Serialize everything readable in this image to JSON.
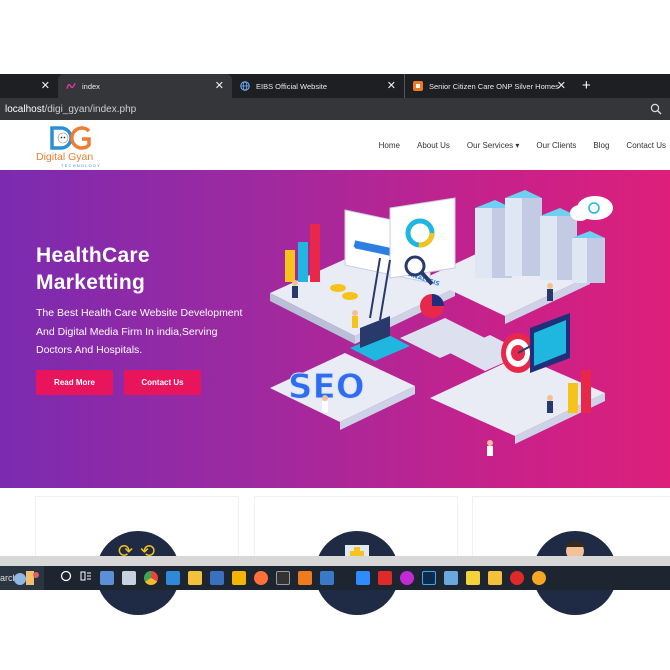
{
  "browser": {
    "tabs": [
      {
        "label": ""
      },
      {
        "label": "index"
      },
      {
        "label": "EIBS Official Website"
      },
      {
        "label": "Senior Citizen Care ONP Silver Homes"
      }
    ],
    "new_tab": "+",
    "close_glyph": "✕",
    "url_host": "localhost",
    "url_path": "/digi_gyan/index.php"
  },
  "site": {
    "logo_text": "Digital Gyan",
    "logo_sub": "TECHNOLOGY",
    "nav": [
      "Home",
      "About Us",
      "Our Services ▾",
      "Our Clients",
      "Blog",
      "Contact Us"
    ]
  },
  "hero": {
    "title_line1": "HealthCare",
    "title_line2": "Marketting",
    "subtitle": "The Best Health Care Website Development And Digital Media Firm In india,Serving Doctors And Hospitals.",
    "read_more": "Read More",
    "contact_us": "Contact Us",
    "illustration_labels": [
      "MONITORING",
      "ANALYSIS",
      "SEO"
    ]
  },
  "taskbar": {
    "search_fragment": "arch"
  },
  "colors": {
    "accent_pink": "#e8145c",
    "hero_start": "#7b2bb0",
    "hero_end": "#dd1f7a",
    "logo_orange": "#ec7d32",
    "logo_blue": "#2b8fd6"
  }
}
